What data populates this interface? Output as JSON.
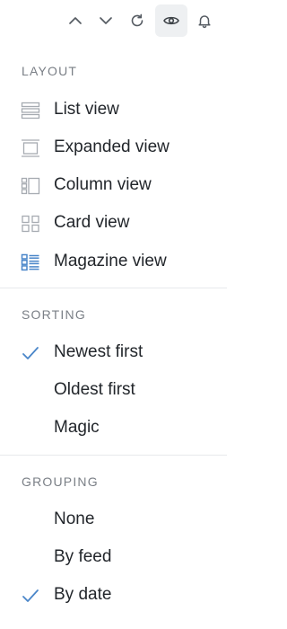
{
  "toolbar": {
    "buttons": [
      {
        "icon": "chevron-up-icon"
      },
      {
        "icon": "chevron-down-icon"
      },
      {
        "icon": "refresh-icon"
      },
      {
        "icon": "eye-icon",
        "active": true
      },
      {
        "icon": "bell-icon"
      }
    ]
  },
  "layout": {
    "heading": "LAYOUT",
    "items": [
      {
        "label": "List view",
        "icon": "list-view-icon",
        "selected": false
      },
      {
        "label": "Expanded view",
        "icon": "expanded-view-icon",
        "selected": false
      },
      {
        "label": "Column view",
        "icon": "column-view-icon",
        "selected": false
      },
      {
        "label": "Card view",
        "icon": "card-view-icon",
        "selected": false
      },
      {
        "label": "Magazine view",
        "icon": "magazine-view-icon",
        "selected": true
      }
    ]
  },
  "sorting": {
    "heading": "SORTING",
    "items": [
      {
        "label": "Newest first",
        "checked": true
      },
      {
        "label": "Oldest first",
        "checked": false
      },
      {
        "label": "Magic",
        "checked": false
      }
    ]
  },
  "grouping": {
    "heading": "GROUPING",
    "items": [
      {
        "label": "None",
        "checked": false
      },
      {
        "label": "By feed",
        "checked": false
      },
      {
        "label": "By date",
        "checked": true
      }
    ]
  },
  "colors": {
    "accent": "#4a86c9",
    "icon_muted": "#a6abb1",
    "heading": "#7a7f86",
    "divider": "#e7e9ec",
    "active_button_bg": "#eef0f2"
  }
}
